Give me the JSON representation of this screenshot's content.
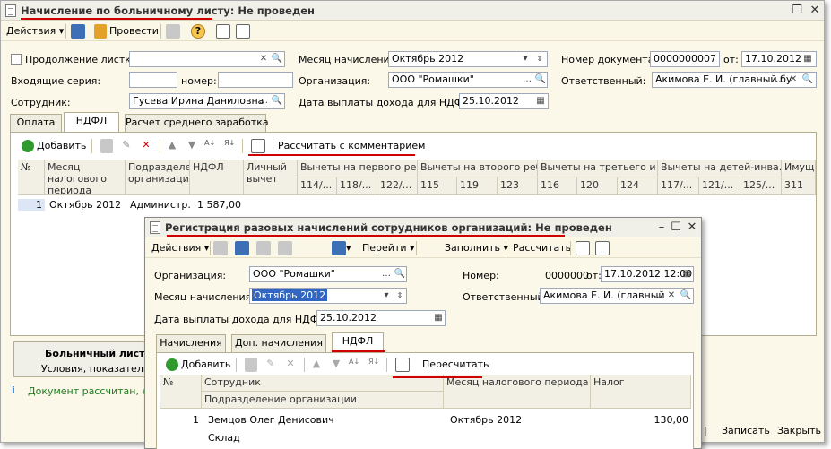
{
  "main": {
    "title": "Начисление по больничному листу: Не проведен",
    "toolbar": {
      "actions": "Действия",
      "post": "Провести"
    },
    "form": {
      "continuation_label": "Продолжение листка",
      "month_label": "Месяц начисления:",
      "month_value": "Октябрь 2012",
      "docnum_label": "Номер документа:",
      "docnum_value": "0000000007",
      "from_label": "от:",
      "date_value": "17.10.2012",
      "series_label": "Входящие серия:",
      "number_label": "номер:",
      "org_label": "Организация:",
      "org_value": "ООО \"Ромашки\"",
      "resp_label": "Ответственный:",
      "resp_value": "Акимова Е. И. (главный бу",
      "employee_label": "Сотрудник:",
      "employee_value": "Гусева Ирина Даниловна",
      "payout_label": "Дата выплаты дохода для НДФЛ:",
      "payout_value": "25.10.2012"
    },
    "tabs": [
      "Оплата",
      "НДФЛ",
      "Расчет среднего заработка"
    ],
    "grid_toolbar": {
      "add": "Добавить",
      "calc": "Рассчитать с комментарием"
    },
    "grid": {
      "headers": {
        "num": "№",
        "month": "Месяц налогового периода",
        "dept": "Подразделение организации",
        "ndfl": "НДФЛ",
        "personal": "Личный вычет",
        "ded1": "Вычеты на первого ре...",
        "ded2": "Вычеты на второго реб...",
        "ded3": "Вычеты на третьего и ...",
        "ded4": "Вычеты на детей-инва...",
        "imu": "Имущ"
      },
      "codes": [
        "114/...",
        "118/...",
        "122/...",
        "115",
        "119",
        "123",
        "116",
        "120",
        "124",
        "117/...",
        "121/...",
        "125/...",
        "311"
      ],
      "row": {
        "num": "1",
        "month": "Октябрь 2012",
        "dept": "Администр...",
        "ndfl": "1 587,00"
      }
    },
    "bottom_panel": {
      "title": "Больничный лист",
      "subtitle": "Условия, показатели"
    },
    "status": "Документ рассчитан, но н",
    "footer": {
      "save": "Записать",
      "close": "Закрыть"
    }
  },
  "overlay": {
    "title": "Регистрация разовых начислений сотрудников организаций: Не проведен",
    "toolbar": {
      "actions": "Действия",
      "goto": "Перейти",
      "fill": "Заполнить",
      "calc": "Рассчитать"
    },
    "form": {
      "org_label": "Организация:",
      "org_value": "ООО \"Ромашки\"",
      "num_label": "Номер:",
      "num_value": "0000000",
      "from_label": "от:",
      "date_value": "17.10.2012 12:00",
      "month_label": "Месяц начисления:",
      "month_value": "Октябрь 2012",
      "resp_label": "Ответственный:",
      "resp_value": "Акимова Е. И. (главный",
      "payout_label": "Дата выплаты дохода для НДФЛ:",
      "payout_value": "25.10.2012"
    },
    "tabs": [
      "Начисления",
      "Доп. начисления",
      "НДФЛ"
    ],
    "grid_toolbar": {
      "add": "Добавить",
      "recalc": "Пересчитать"
    },
    "grid": {
      "headers": {
        "num": "№",
        "employee": "Сотрудник",
        "dept": "Подразделение организации",
        "month": "Месяц налогового периода",
        "tax": "Налог"
      },
      "row": {
        "num": "1",
        "employee": "Земцов Олег Денисович",
        "month": "Октябрь 2012",
        "tax": "130,00",
        "dept": "Склад"
      }
    }
  }
}
